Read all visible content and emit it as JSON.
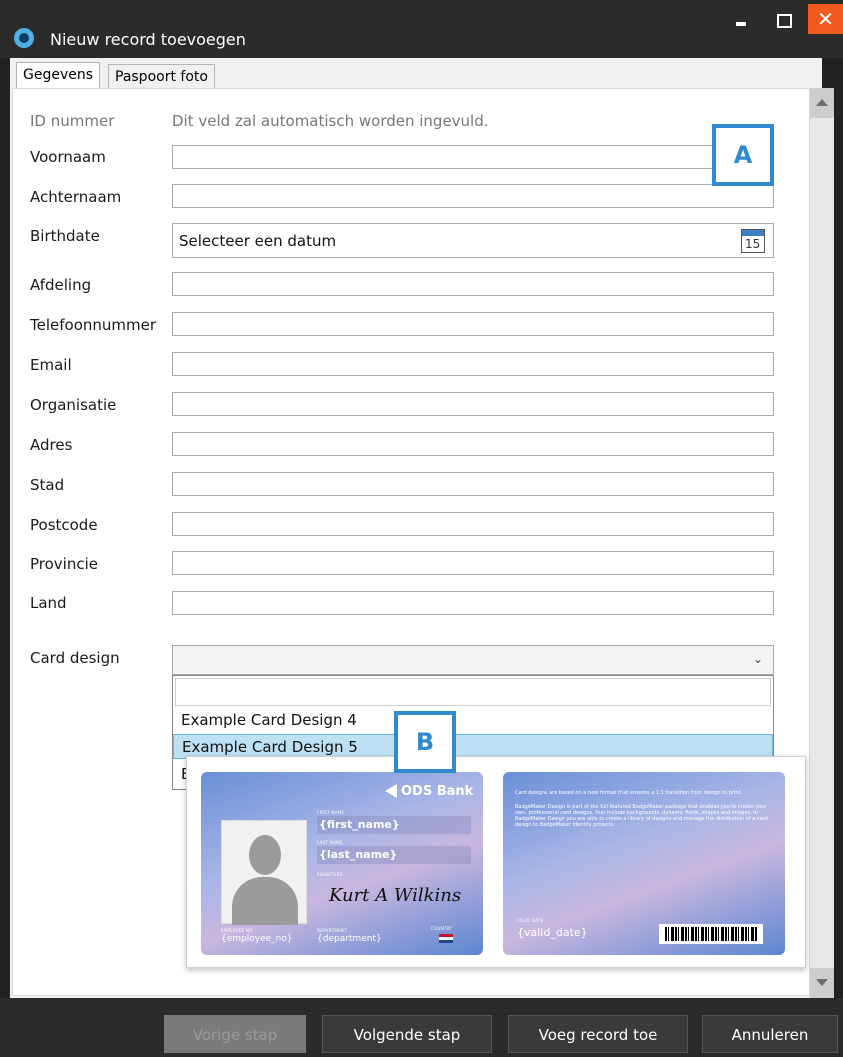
{
  "window": {
    "title": "Nieuw record toevoegen",
    "minimize": "",
    "maximize": "",
    "close": "✕"
  },
  "tabs": [
    {
      "label": "Gegevens",
      "active": true
    },
    {
      "label": "Paspoort foto",
      "active": false
    }
  ],
  "form": {
    "id_label": "ID nummer",
    "id_hint": "Dit veld zal automatisch worden ingevuld.",
    "fields": [
      {
        "label": "Voornaam",
        "value": ""
      },
      {
        "label": "Achternaam",
        "value": ""
      },
      {
        "label": "Birthdate",
        "value": "Selecteer een datum"
      },
      {
        "label": "Afdeling",
        "value": ""
      },
      {
        "label": "Telefoonnummer",
        "value": ""
      },
      {
        "label": "Email",
        "value": ""
      },
      {
        "label": "Organisatie",
        "value": ""
      },
      {
        "label": "Adres",
        "value": ""
      },
      {
        "label": "Stad",
        "value": ""
      },
      {
        "label": "Postcode",
        "value": ""
      },
      {
        "label": "Provincie",
        "value": ""
      },
      {
        "label": "Land",
        "value": ""
      }
    ],
    "calendar_day": "15",
    "card_design_label": "Card design",
    "card_design_value": "",
    "card_design_chevron": "⌄"
  },
  "dropdown": {
    "search_value": "",
    "options": [
      "Example Card Design 4",
      "Example Card Design 5",
      "E"
    ],
    "selected_index": 1
  },
  "badges": {
    "a": "A",
    "b": "B"
  },
  "preview": {
    "front": {
      "bank_name": "ODS Bank",
      "first_name_label": "FIRST NAME",
      "first_name": "{first_name}",
      "last_name_label": "LAST NAME",
      "last_name": "{last_name}",
      "signature_label": "SIGNATURE",
      "signature": "Kurt A Wilkins",
      "employee_label": "EMPLOYEE NO",
      "employee": "{employee_no}",
      "department_label": "DEPARTMENT",
      "department": "{department}",
      "country_label": "COUNTRY"
    },
    "back": {
      "line1": "Card designs are based on a new format that ensures a 1:1 transition from design to print.",
      "line2": "BadgeMaker Design is part of the full featured BadgeMaker package that enables you to create your own, professional card designs, that include backgrounds, dynamic fields, shapes and images. In BadgeMaker Design you are able to create a library of designs and manage the distribution of a card design to BadgeMaker Identity projects.",
      "valid_label": "VALID DATE",
      "valid": "{valid_date}"
    }
  },
  "footer": {
    "prev": "Vorige stap",
    "next": "Volgende stap",
    "add": "Voeg record toe",
    "cancel": "Annuleren"
  },
  "colors": {
    "accent": "#2f8ad0",
    "close": "#f25b1f",
    "selected_option": "#bde0f4"
  }
}
